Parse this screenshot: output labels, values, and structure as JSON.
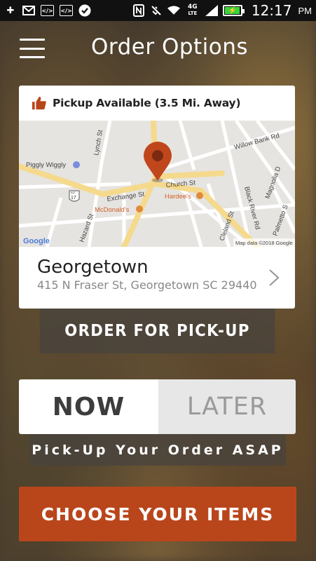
{
  "status_bar": {
    "time": "12:17",
    "ampm": "PM",
    "network": "4G",
    "network_sub": "LTE",
    "icons": [
      "add-icon",
      "gmail-icon",
      "code-icon",
      "code-icon",
      "check-icon",
      "nfc-icon",
      "vibrate-icon",
      "wifi-icon",
      "signal-icon",
      "battery-icon"
    ],
    "battery_level": 0.88
  },
  "header": {
    "title": "Order Options",
    "menu_icon": "hamburger-menu-icon"
  },
  "pickup": {
    "status_text": "Pickup Available (3.5 Mi. Away)",
    "icon": "thumbs-up-icon",
    "icon_color": "#b9461b"
  },
  "map": {
    "labels": {
      "piggly": "Piggly Wiggly",
      "lynch": "Lynch St",
      "willow": "Willow Bank Rd",
      "church": "Church St",
      "hardees": "Hardee's",
      "exchange": "Exchange St",
      "mcdonalds": "McDonald's",
      "black_river": "Black River Rd",
      "magnolia": "Magnolia D",
      "palmetto": "Palmetto S",
      "hazard": "Hazard St",
      "cleland": "Cleland St",
      "route": "17",
      "route_top": "ALT",
      "google": "Google",
      "attribution": "Map data ©2018 Google"
    },
    "pin_color": "#c0461b"
  },
  "location": {
    "name": "Georgetown",
    "address": "415 N Fraser St, Georgetown SC 29440"
  },
  "order_pickup_label": "ORDER FOR PICK-UP",
  "timing": {
    "now_label": "NOW",
    "later_label": "LATER",
    "selected": "NOW",
    "asap_text": "Pick-Up Your Order ASAP"
  },
  "choose_items_label": "CHOOSE YOUR ITEMS",
  "colors": {
    "accent": "#b9461b"
  }
}
